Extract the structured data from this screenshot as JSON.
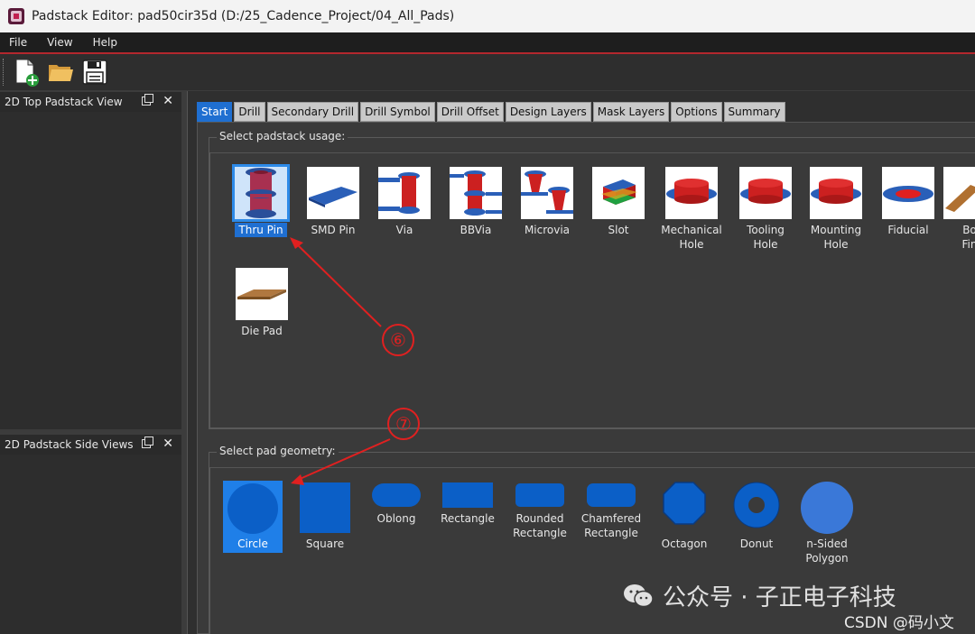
{
  "window": {
    "title": "Padstack Editor: pad50cir35d  (D:/25_Cadence_Project/04_All_Pads)"
  },
  "menubar": {
    "items": [
      "File",
      "View",
      "Help"
    ]
  },
  "toolbar": {
    "buttons": [
      "new-icon",
      "open-folder-icon",
      "save-icon"
    ]
  },
  "docks": {
    "top_view": {
      "title": "2D Top Padstack View"
    },
    "side_views": {
      "title": "2D Padstack Side Views"
    }
  },
  "tabs": [
    "Start",
    "Drill",
    "Secondary Drill",
    "Drill Symbol",
    "Drill Offset",
    "Design Layers",
    "Mask Layers",
    "Options",
    "Summary"
  ],
  "active_tab": "Start",
  "usage": {
    "label": "Select padstack usage:",
    "items": [
      {
        "label": "Thru Pin",
        "selected": true
      },
      {
        "label": "SMD Pin"
      },
      {
        "label": "Via"
      },
      {
        "label": "BBVia"
      },
      {
        "label": "Microvia"
      },
      {
        "label": "Slot"
      },
      {
        "label": "Mechanical\nHole"
      },
      {
        "label": "Tooling\nHole"
      },
      {
        "label": "Mounting\nHole"
      },
      {
        "label": "Fiducial"
      },
      {
        "label": "Bo\nFin"
      },
      {
        "label": "Die Pad"
      }
    ]
  },
  "geometry": {
    "label": "Select pad geometry:",
    "items": [
      {
        "label": "Circle",
        "selected": true
      },
      {
        "label": "Square"
      },
      {
        "label": "Oblong"
      },
      {
        "label": "Rectangle"
      },
      {
        "label": "Rounded\nRectangle"
      },
      {
        "label": "Chamfered\nRectangle"
      },
      {
        "label": "Octagon"
      },
      {
        "label": "Donut"
      },
      {
        "label": "n-Sided\nPolygon"
      }
    ]
  },
  "annotations": {
    "step6": "⑥",
    "step7": "⑦"
  },
  "watermark": {
    "text": "公众号 · 子正电子科技",
    "csdn": "CSDN @码小文"
  },
  "colors": {
    "accent": "#1f6fd1",
    "pad_blue": "#0b5fc7",
    "annotation_red": "#e02020",
    "menu_border": "#b3272d"
  }
}
